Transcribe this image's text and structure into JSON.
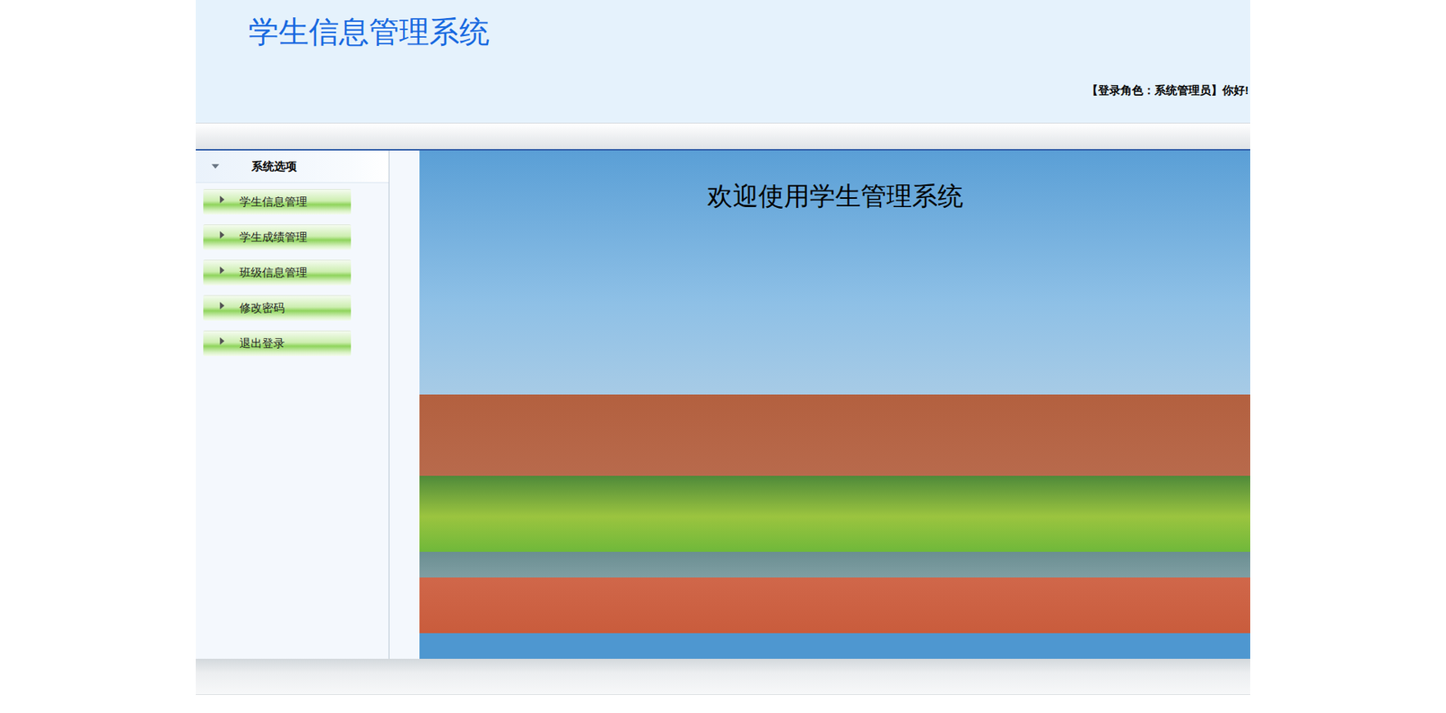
{
  "header": {
    "title": "学生信息管理系统",
    "greeting": "【登录角色：系统管理员】你好!"
  },
  "sidebar": {
    "title": "系统选项",
    "expanded": true,
    "items": [
      {
        "label": "学生信息管理"
      },
      {
        "label": "学生成绩管理"
      },
      {
        "label": "班级信息管理"
      },
      {
        "label": "修改密码"
      },
      {
        "label": "退出登录"
      }
    ]
  },
  "main": {
    "welcome": "欢迎使用学生管理系统"
  }
}
